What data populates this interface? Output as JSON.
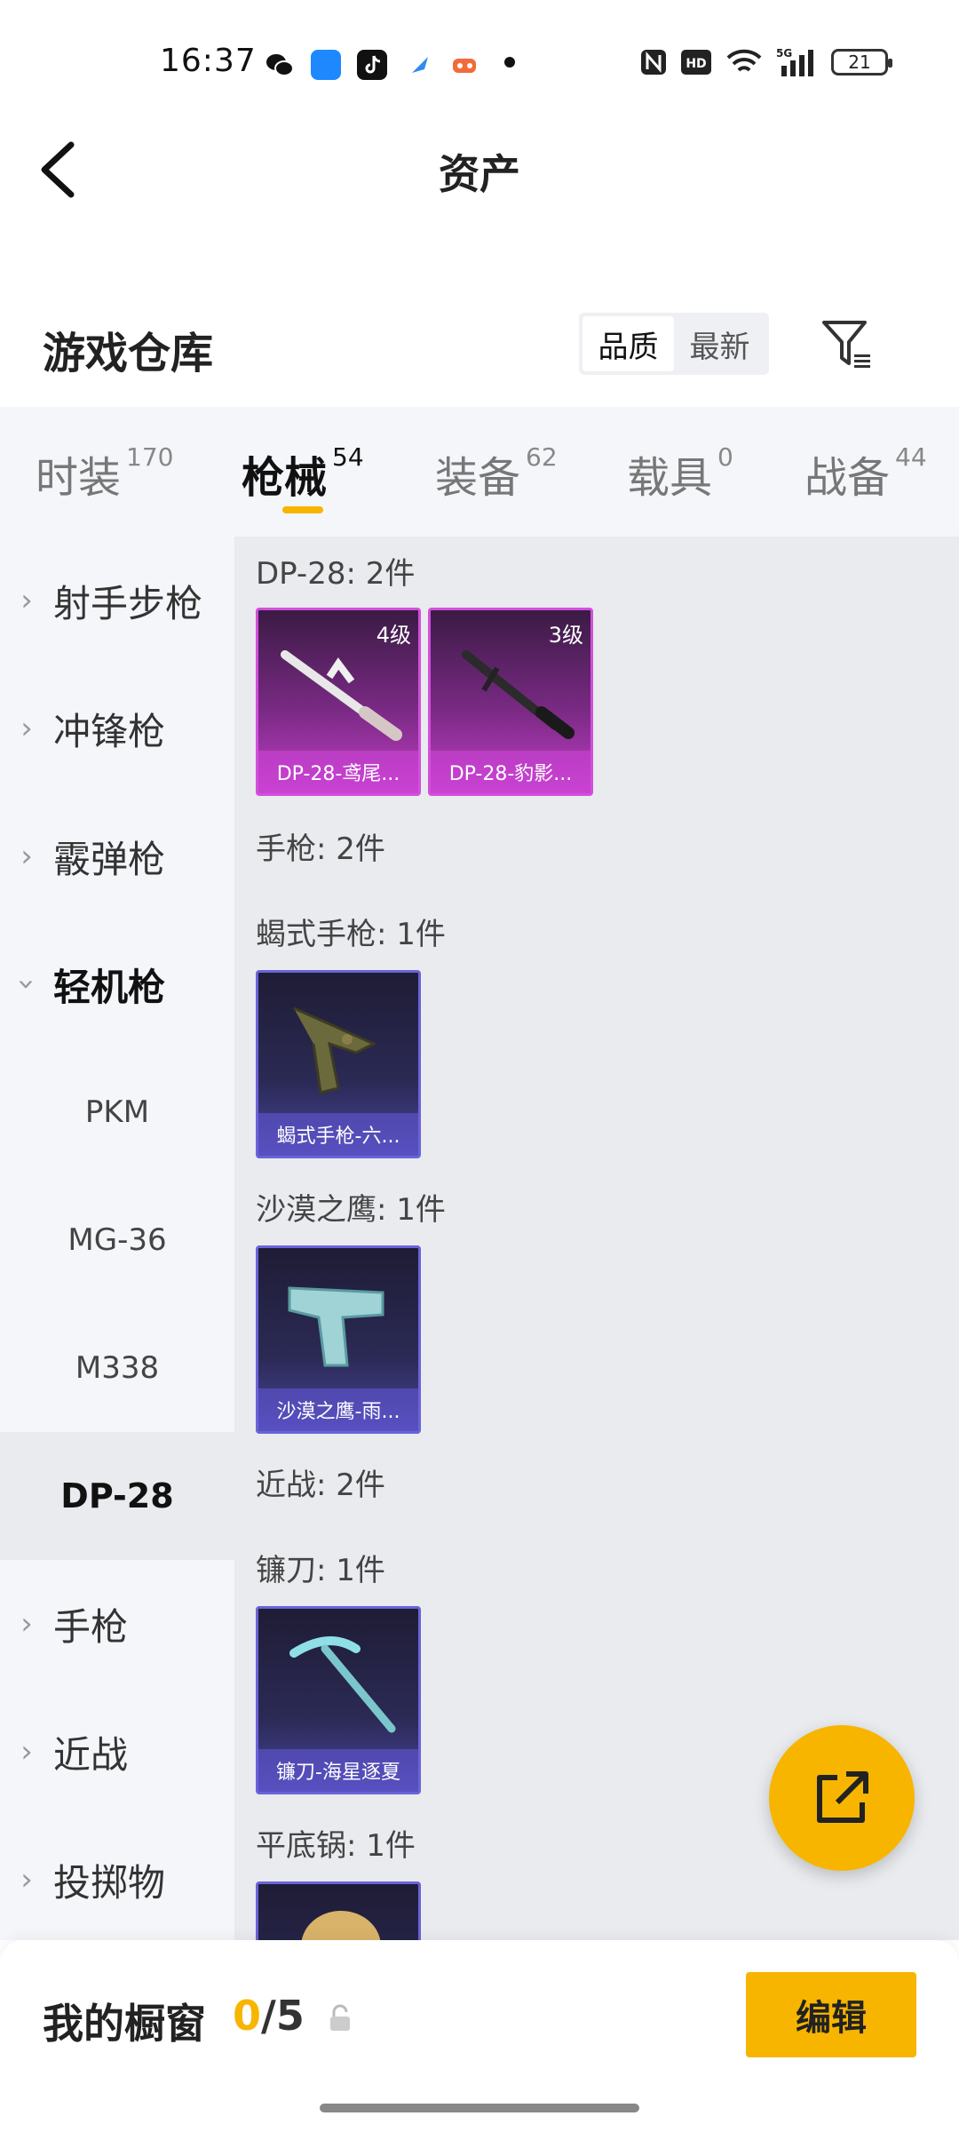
{
  "status_bar": {
    "time": "16:37",
    "battery": "21",
    "network": "5G"
  },
  "header": {
    "title": "资产"
  },
  "warehouse": {
    "title": "游戏仓库",
    "sort_options": [
      "品质",
      "最新"
    ],
    "active_sort": "品质"
  },
  "tabs": [
    {
      "label": "时装",
      "count": "170"
    },
    {
      "label": "枪械",
      "count": "54"
    },
    {
      "label": "装备",
      "count": "62"
    },
    {
      "label": "载具",
      "count": "0"
    },
    {
      "label": "战备",
      "count": "44"
    }
  ],
  "sidebar": {
    "items": [
      {
        "label": "射手步枪"
      },
      {
        "label": "冲锋枪"
      },
      {
        "label": "霰弹枪"
      },
      {
        "label": "轻机枪"
      },
      {
        "label": "PKM"
      },
      {
        "label": "MG-36"
      },
      {
        "label": "M338"
      },
      {
        "label": "DP-28"
      },
      {
        "label": "手枪"
      },
      {
        "label": "近战"
      },
      {
        "label": "投掷物"
      }
    ]
  },
  "content": {
    "sections": [
      {
        "heading": "DP-28: 2件"
      },
      {
        "heading": "手枪: 2件"
      },
      {
        "heading": "蝎式手枪: 1件"
      },
      {
        "heading": "沙漠之鹰: 1件"
      },
      {
        "heading": "近战: 2件"
      },
      {
        "heading": "镰刀: 1件"
      },
      {
        "heading": "平底锅: 1件"
      }
    ],
    "cards": [
      {
        "name": "DP-28-鸢尾...",
        "level": "4级"
      },
      {
        "name": "DP-28-豹影...",
        "level": "3级"
      },
      {
        "name": "蝎式手枪-六..."
      },
      {
        "name": "沙漠之鹰-雨..."
      },
      {
        "name": "镰刀-海星逐夏"
      }
    ]
  },
  "bottom": {
    "showcase_label": "我的橱窗",
    "showcase_current": "0",
    "showcase_total": "/5",
    "edit_label": "编辑"
  },
  "colors": {
    "accent": "#f7b500",
    "card_pink": "#c23ec8",
    "card_blue": "#4a45a0"
  }
}
